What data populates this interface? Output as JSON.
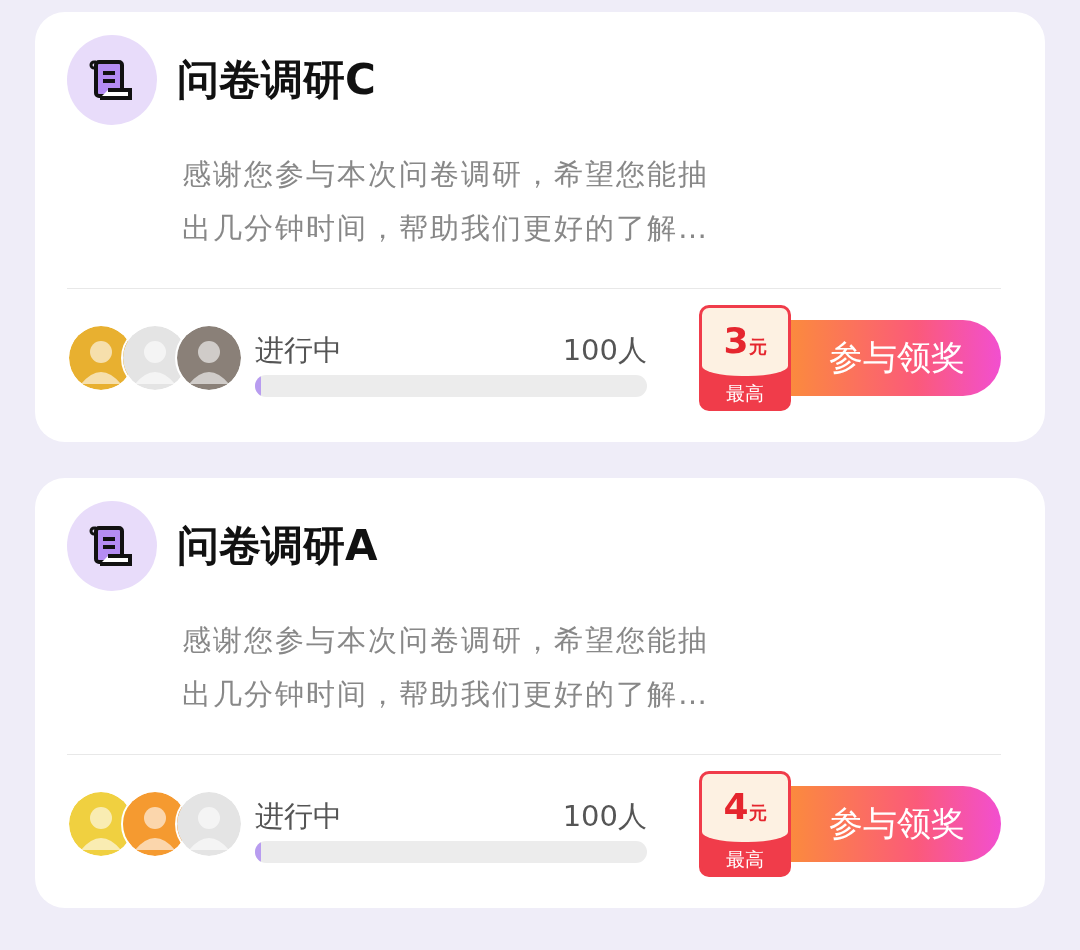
{
  "surveys": [
    {
      "title": "问卷调研C",
      "description": "感谢您参与本次问卷调研，希望您能抽出几分钟时间，帮助我们更好的了解…",
      "avatars": [
        {
          "color": "#e8b030"
        },
        {
          "color": "#e4e4e4"
        },
        {
          "color": "#8a8078"
        }
      ],
      "status": "进行中",
      "count": "100人",
      "level": 0.015,
      "reward_amount": "3",
      "reward_unit": "元",
      "reward_caption": "最高",
      "action": "参与领奖"
    },
    {
      "title": "问卷调研A",
      "description": "感谢您参与本次问卷调研，希望您能抽出几分钟时间，帮助我们更好的了解…",
      "avatars": [
        {
          "color": "#f0d040"
        },
        {
          "color": "#f59a30"
        },
        {
          "color": "#e4e4e4"
        }
      ],
      "status": "进行中",
      "count": "100人",
      "level": 0.015,
      "reward_amount": "4",
      "reward_unit": "元",
      "reward_caption": "最高",
      "action": "参与领奖"
    }
  ]
}
